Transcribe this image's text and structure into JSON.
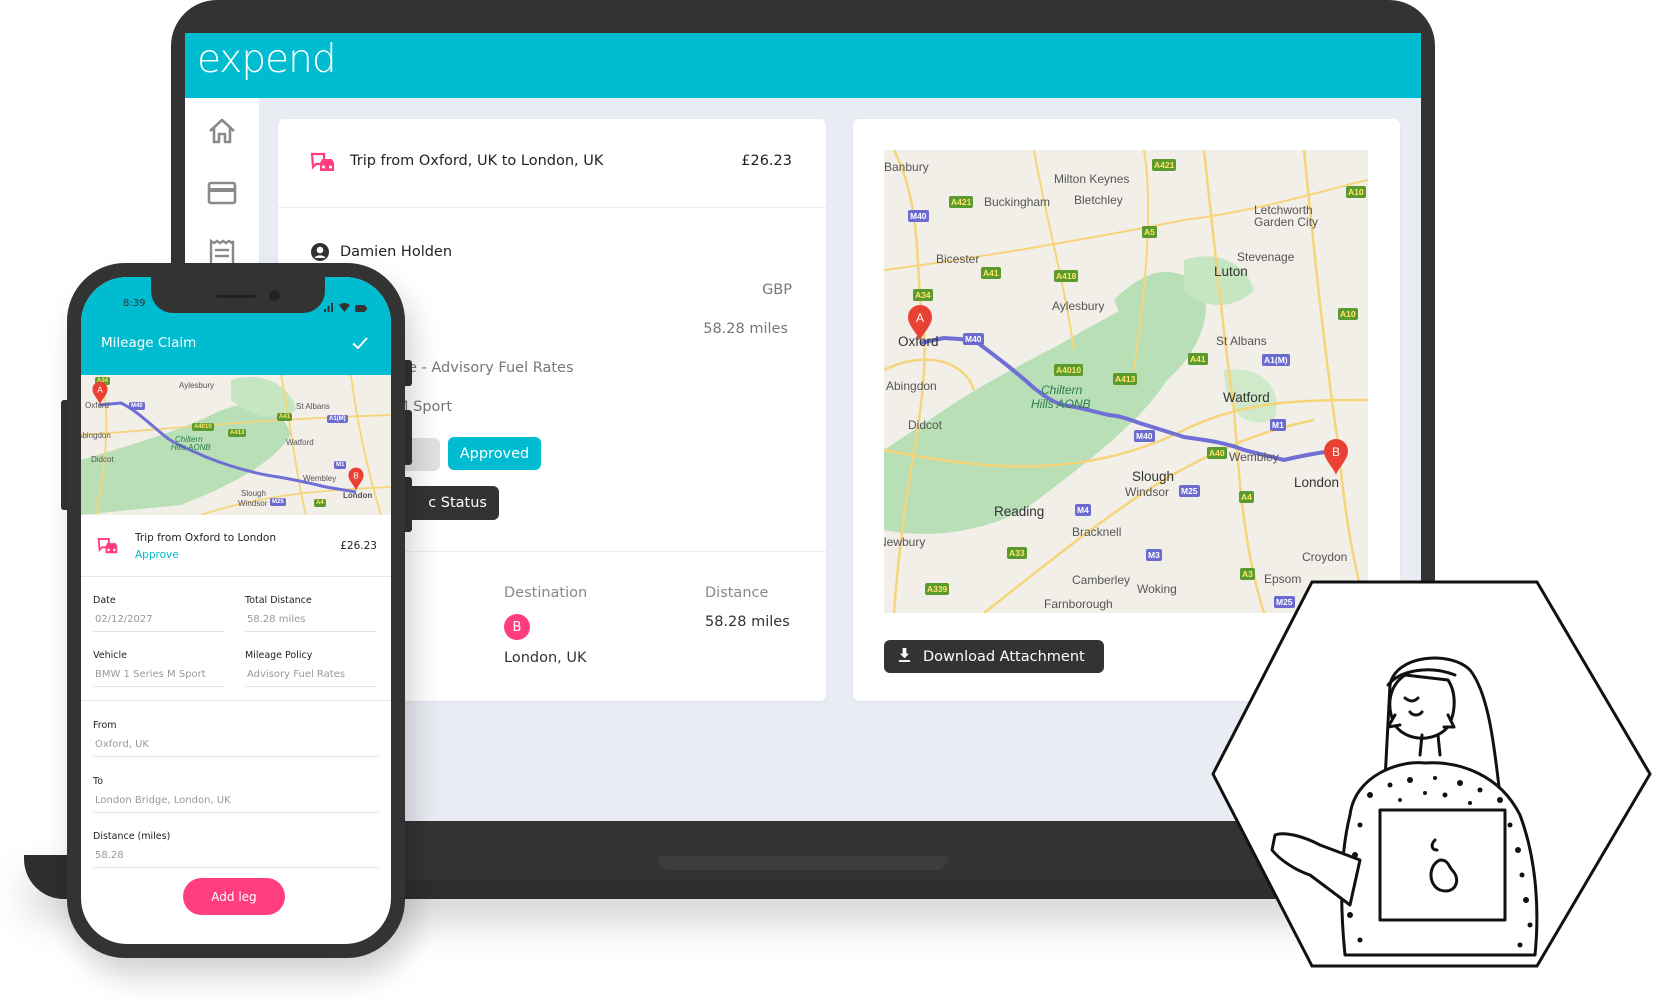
{
  "app": {
    "logo": "expend",
    "brand_color": "#00bcd0",
    "accent_color": "#ff3d7f"
  },
  "sidebar": {
    "items": [
      {
        "icon": "home-icon"
      },
      {
        "icon": "credit-card-icon"
      },
      {
        "icon": "receipt-icon"
      }
    ]
  },
  "expense_card": {
    "title": "Trip from Oxford, UK to London, UK",
    "amount": "£26.23",
    "user_name": "Damien Holden",
    "currency": "GBP",
    "distance": "58.28 miles",
    "policy_partial": "cle - Advisory Fuel Rates",
    "vehicle_partial": "M Sport",
    "status_button": "Approved",
    "sync_button_partial": "c Status",
    "columns": {
      "destination_label": "Destination",
      "distance_label": "Distance"
    },
    "destination_badge": "B",
    "destination_value": "London, UK",
    "distance_value": "58.28 miles"
  },
  "map_card": {
    "download_button": "Download Attachment",
    "pins": {
      "start": "A",
      "end": "B"
    },
    "places": [
      "Banbury",
      "Milton Keynes",
      "Buckingham",
      "Bletchley",
      "Letchworth",
      "Garden City",
      "Bicester",
      "Stevenage",
      "Luton",
      "Aylesbury",
      "Oxford",
      "St Albans",
      "Abingdon",
      "Chiltern",
      "Hills AONB",
      "Watford",
      "Didcot",
      "Wembley",
      "Slough",
      "Windsor",
      "London",
      "Reading",
      "Bracknell",
      "Newbury",
      "Croydon",
      "Camberley",
      "Woking",
      "Epsom",
      "Farnborough"
    ],
    "roads": [
      "A421",
      "A10",
      "A421",
      "M40",
      "A5",
      "A41",
      "A418",
      "A34",
      "A10",
      "M40",
      "A41",
      "A1(M)",
      "A4010",
      "A413",
      "M1",
      "M40",
      "A40",
      "M25",
      "A4",
      "M4",
      "A33",
      "M3",
      "A3",
      "A339",
      "M25"
    ]
  },
  "phone": {
    "time": "8:39",
    "title": "Mileage Claim",
    "trip_title": "Trip from Oxford to London",
    "approve_link": "Approve",
    "amount": "£26.23",
    "fields": {
      "date": {
        "label": "Date",
        "value": "02/12/2027"
      },
      "total_distance": {
        "label": "Total Distance",
        "value": "58.28 miles"
      },
      "vehicle": {
        "label": "Vehicle",
        "value": "BMW 1 Series M Sport"
      },
      "mileage_policy": {
        "label": "Mileage Policy",
        "value": "Advisory Fuel Rates"
      },
      "from": {
        "label": "From",
        "value": "Oxford, UK"
      },
      "to": {
        "label": "To",
        "value": "London Bridge, London, UK"
      },
      "distance": {
        "label": "Distance (miles)",
        "value": "58.28"
      }
    },
    "add_leg_button": "Add leg",
    "map_places": [
      "Aylesbury",
      "Oxford",
      "St Albans",
      "Abingdon",
      "Chiltern",
      "Hills AONB",
      "Watford",
      "Didcot",
      "Wembley",
      "Slough",
      "Windsor",
      "London"
    ],
    "map_roads": [
      "A34",
      "M40",
      "A41",
      "A1(M)",
      "A4010",
      "A413",
      "M1",
      "M25",
      "A4"
    ]
  }
}
